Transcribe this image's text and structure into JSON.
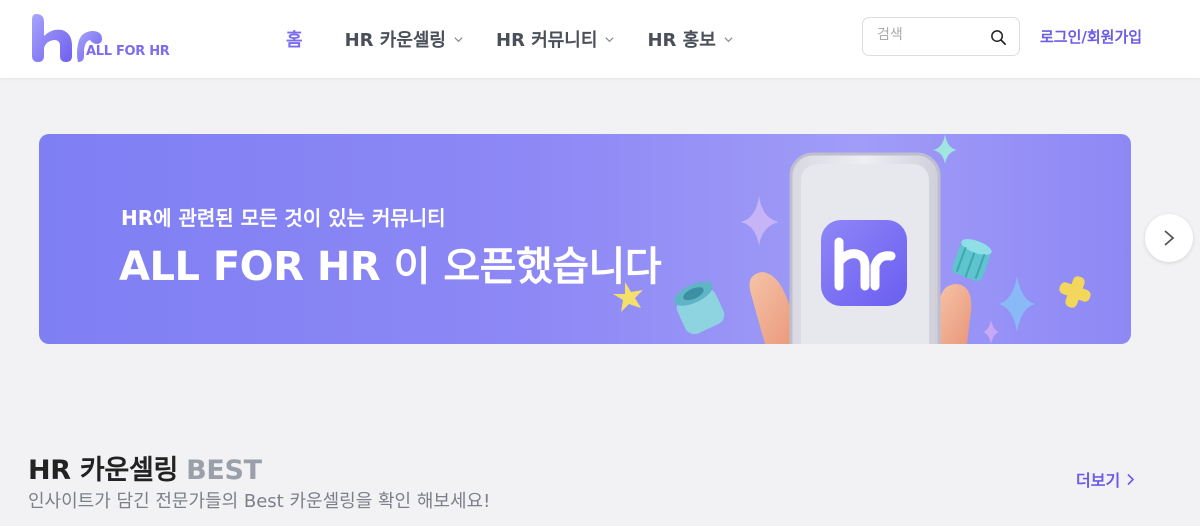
{
  "header": {
    "logo_text": "ALL FOR HR",
    "nav": [
      {
        "label": "홈",
        "active": true,
        "has_dropdown": false
      },
      {
        "label": "HR 카운셀링",
        "active": false,
        "has_dropdown": true
      },
      {
        "label": "HR 커뮤니티",
        "active": false,
        "has_dropdown": true
      },
      {
        "label": "HR 홍보",
        "active": false,
        "has_dropdown": true
      }
    ],
    "search": {
      "placeholder": "검색",
      "value": ""
    },
    "login_label": "로그인/회원가입"
  },
  "banner": {
    "subtitle": "HR에 관련된 모든 것이 있는 커뮤니티",
    "title": "ALL FOR HR 이 오픈했습니다"
  },
  "section": {
    "title": "HR 카운셀링",
    "title_badge": "BEST",
    "subtitle": "인사이트가 담긴 전문가들의 Best 카운셀링을 확인 해보세요!",
    "more_label": "더보기"
  },
  "icons": {
    "search": "search-icon",
    "chevron_down": "chevron-down-icon",
    "next": "chevron-right-icon",
    "more": "chevron-right-icon"
  },
  "colors": {
    "accent": "#7b6cf0",
    "banner": "#8d88f5",
    "background": "#f2f2f4"
  }
}
